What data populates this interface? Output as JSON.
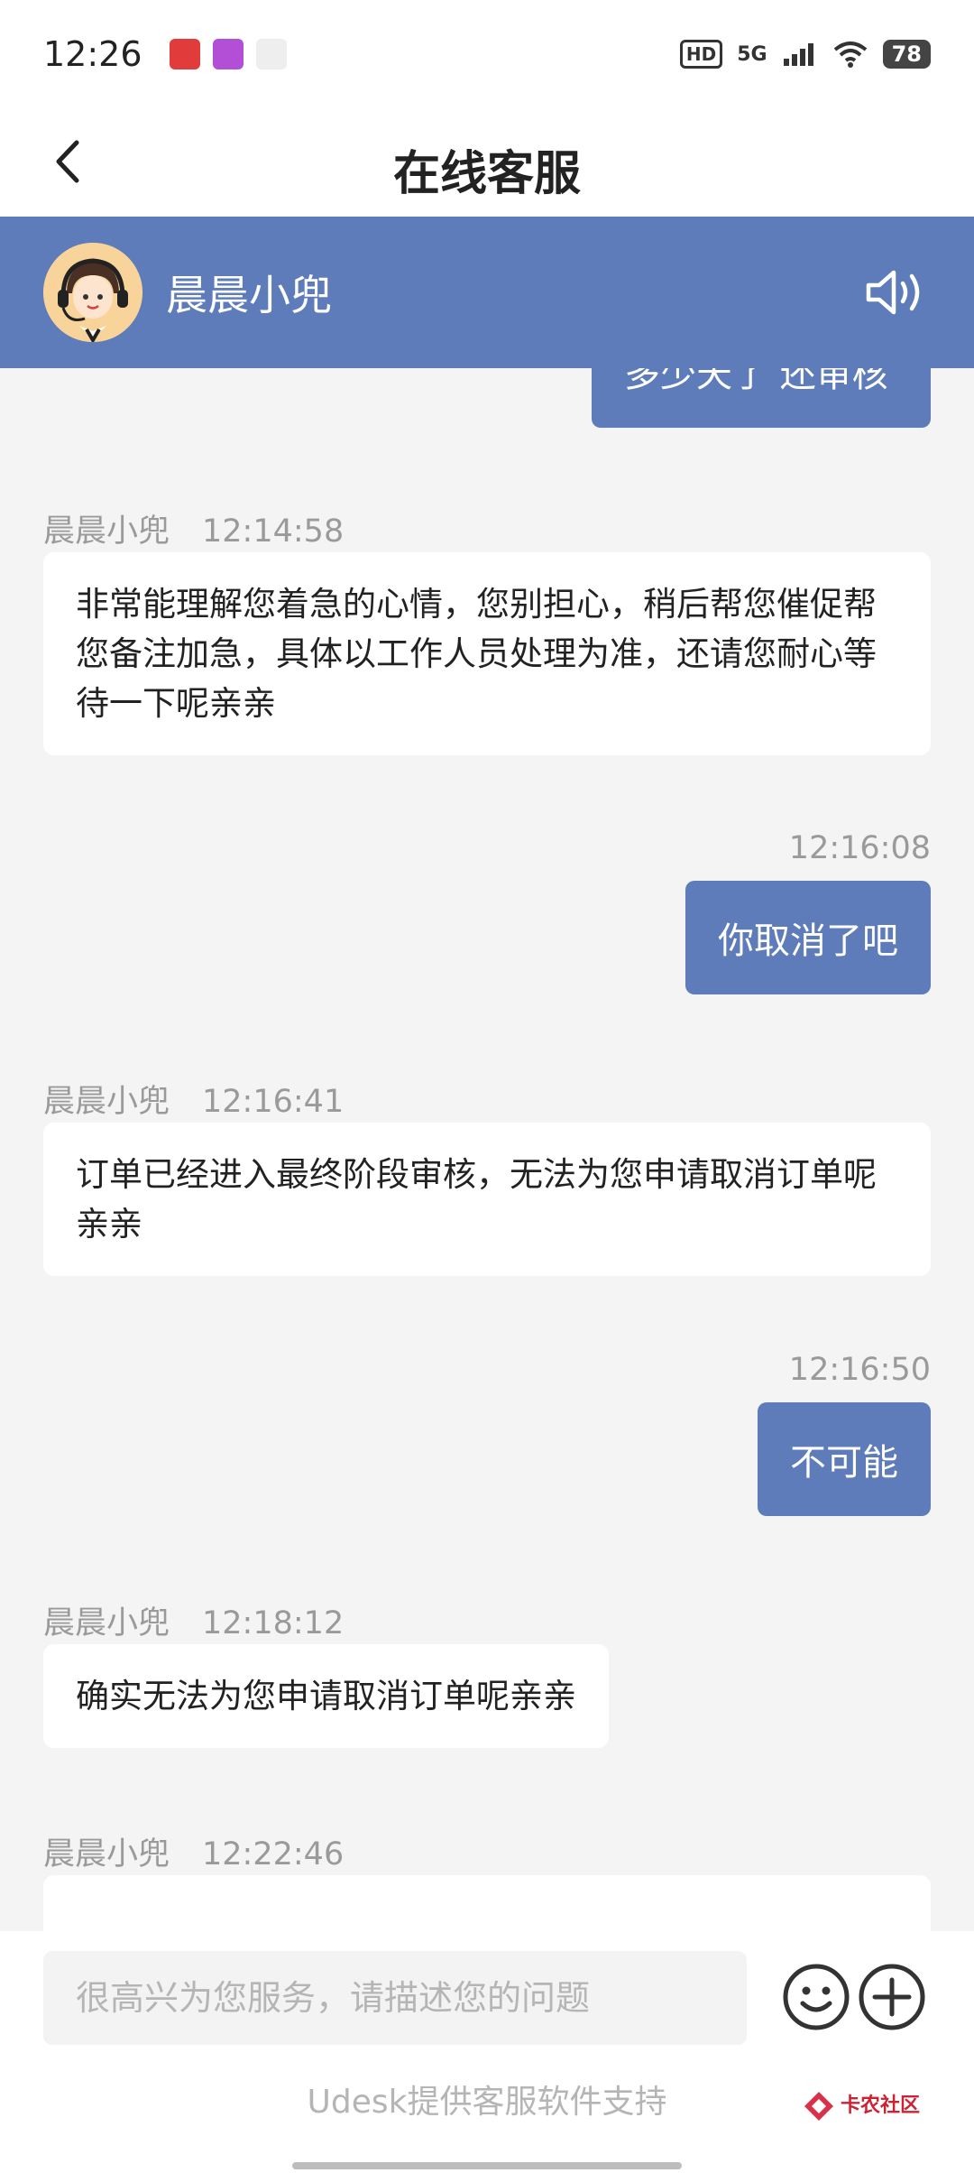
{
  "status_bar": {
    "time": "12:26",
    "hd": "HD",
    "network": "5G",
    "battery": "78"
  },
  "header": {
    "title": "在线客服"
  },
  "agent": {
    "name": "晨晨小兜"
  },
  "messages": {
    "user_partial": "多少天了 还审核",
    "m1": {
      "sender": "晨晨小兜",
      "time": "12:14:58",
      "text": "非常能理解您着急的心情，您别担心，稍后帮您催促帮您备注加急，具体以工作人员处理为准，还请您耐心等待一下呢亲亲"
    },
    "m2": {
      "time": "12:16:08",
      "text": "你取消了吧"
    },
    "m3": {
      "sender": "晨晨小兜",
      "time": "12:16:41",
      "text": "订单已经进入最终阶段审核，无法为您申请取消订单呢亲亲"
    },
    "m4": {
      "time": "12:16:50",
      "text": "不可能"
    },
    "m5": {
      "sender": "晨晨小兜",
      "time": "12:18:12",
      "text": "确实无法为您申请取消订单呢亲亲"
    },
    "m6": {
      "sender": "晨晨小兜",
      "time": "12:22:46"
    }
  },
  "input": {
    "placeholder": "很高兴为您服务，请描述您的问题"
  },
  "footer": {
    "powered_by": "Udesk提供客服软件支持",
    "watermark": "卡农社区"
  },
  "colors": {
    "accent": "#5d7cb9",
    "background": "#f4f4f4"
  }
}
